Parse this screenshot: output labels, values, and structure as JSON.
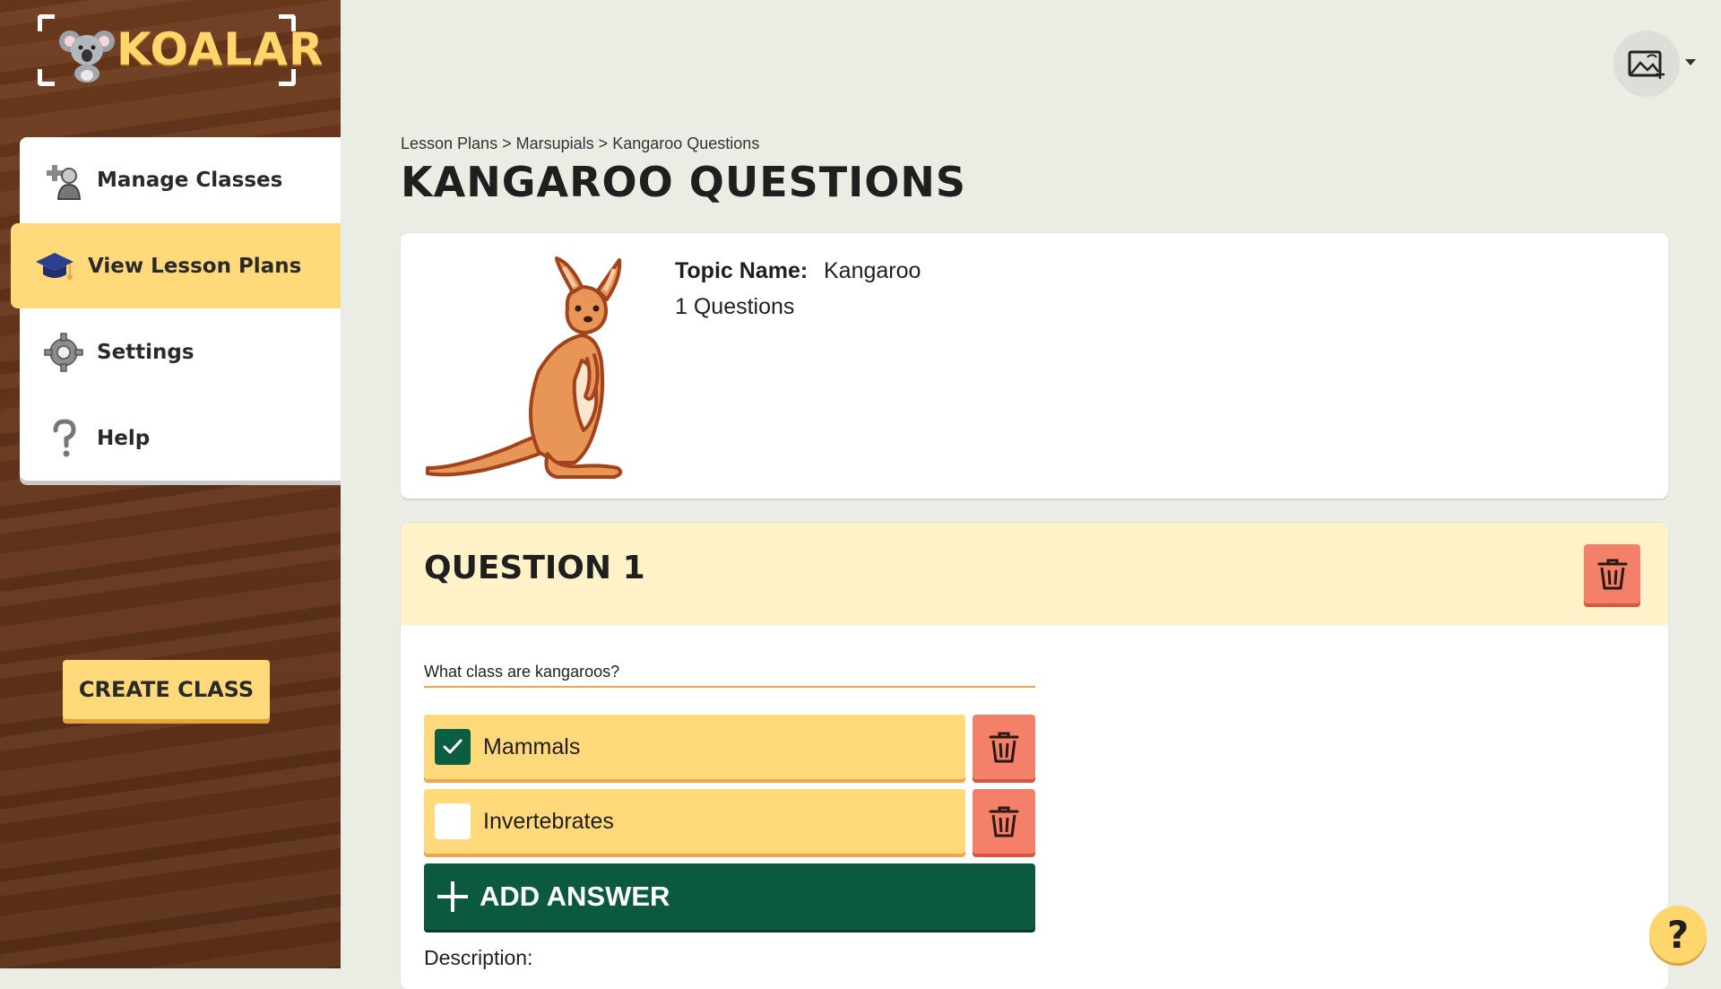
{
  "brand": {
    "name": "KOALAR"
  },
  "sidebar": {
    "items": [
      {
        "label": "Manage Classes",
        "icon": "manage-classes-icon"
      },
      {
        "label": "View Lesson Plans",
        "icon": "graduation-cap-icon",
        "active": true
      },
      {
        "label": "Settings",
        "icon": "gear-icon"
      },
      {
        "label": "Help",
        "icon": "question-mark-icon"
      }
    ],
    "create_class_label": "CREATE CLASS"
  },
  "header": {
    "breadcrumb": [
      "Lesson Plans",
      "Marsupials",
      "Kangaroo Questions"
    ],
    "separator": ">",
    "title": "KANGAROO QUESTIONS"
  },
  "topic": {
    "name_label": "Topic Name:",
    "name_value": "Kangaroo",
    "count_text": "1 Questions",
    "image": "kangaroo-illustration"
  },
  "question": {
    "title": "QUESTION 1",
    "text": "What class are kangaroos?",
    "answers": [
      {
        "text": "Mammals",
        "correct": true
      },
      {
        "text": "Invertebrates",
        "correct": false
      }
    ],
    "add_answer_label": "ADD ANSWER",
    "description_label": "Description:"
  },
  "help_fab": {
    "label": "?"
  },
  "colors": {
    "sidebar_wood": "#66361b",
    "accent_yellow": "#ffd97a",
    "question_header": "#fff2c9",
    "delete_red": "#f4806a",
    "primary_green": "#0b5a3f",
    "page_bg": "#e9ede4"
  }
}
